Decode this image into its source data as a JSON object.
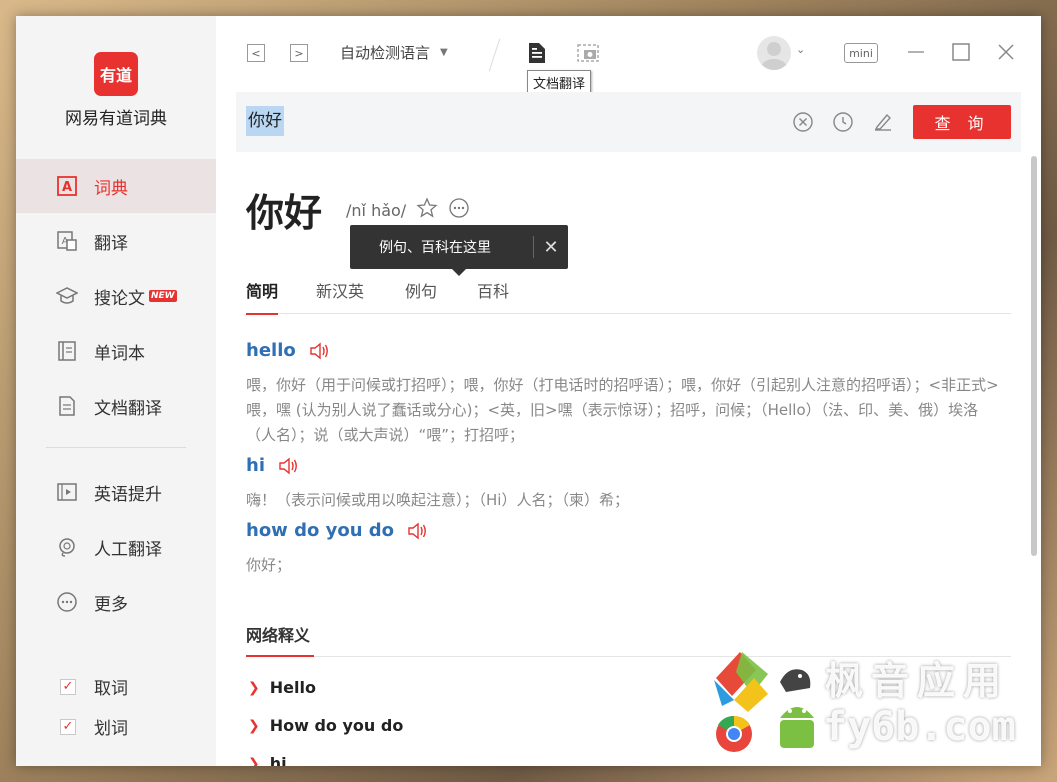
{
  "app": {
    "logo_text": "有道",
    "name": "网易有道词典"
  },
  "sidebar": {
    "items": [
      {
        "label": "词典",
        "icon": "dictionary-icon",
        "active": true
      },
      {
        "label": "翻译",
        "icon": "translate-icon"
      },
      {
        "label": "搜论文",
        "icon": "graduation-cap-icon",
        "badge": "NEW"
      },
      {
        "label": "单词本",
        "icon": "wordbook-icon"
      },
      {
        "label": "文档翻译",
        "icon": "document-icon"
      },
      {
        "label": "英语提升",
        "icon": "video-play-icon"
      },
      {
        "label": "人工翻译",
        "icon": "headset-icon"
      },
      {
        "label": "更多",
        "icon": "more-circle-icon"
      }
    ],
    "checks": [
      {
        "label": "取词",
        "checked": true
      },
      {
        "label": "划词",
        "checked": true
      }
    ]
  },
  "toolbar": {
    "back": "<",
    "forward": ">",
    "language": "自动检测语言",
    "doc_tooltip": "文档翻译",
    "mini_label": "mini"
  },
  "search": {
    "value": "你好",
    "query_button": "查 询"
  },
  "result": {
    "headword": "你好",
    "phonetic": "/nǐ hǎo/",
    "popup_text": "例句、百科在这里",
    "tabs": [
      "简明",
      "新汉英",
      "例句",
      "百科"
    ],
    "entries": [
      {
        "word": "hello",
        "def": "喂，你好（用于问候或打招呼）；喂，你好（打电话时的招呼语）；喂，你好（引起别人注意的招呼语）；<非正式>喂，嘿 (认为别人说了蠢话或分心)；<英，旧>嘿（表示惊讶）；招呼，问候；（Hello）（法、印、美、俄）埃洛（人名）；说（或大声说）“喂”；打招呼；"
      },
      {
        "word": "hi",
        "def": "嗨！（表示问候或用以唤起注意）；（Hi）人名；（柬）希；"
      },
      {
        "word": "how do you do",
        "def": "你好；"
      }
    ],
    "web_section_title": "网络释义",
    "web_items": [
      "Hello",
      "How do you do",
      "hi"
    ]
  },
  "watermark": {
    "line1": "枫音应用",
    "line2": "fy6b.com"
  },
  "colors": {
    "accent": "#e8322f",
    "link": "#2f6fb3"
  }
}
